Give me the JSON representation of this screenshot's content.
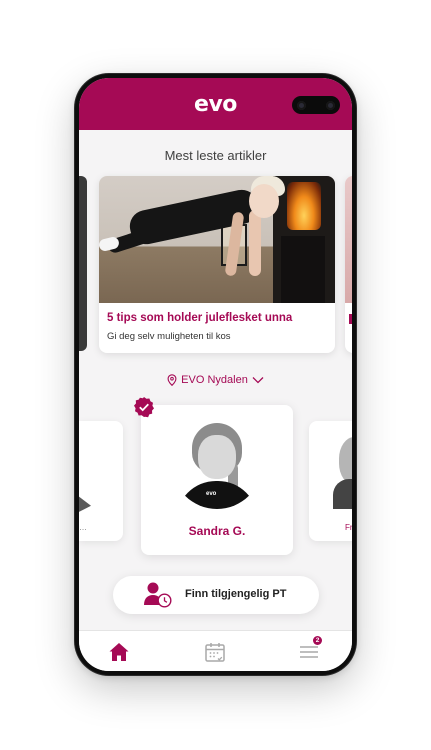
{
  "app": {
    "logo": "evo",
    "brand_color": "#a50a55"
  },
  "articles": {
    "section_title": "Mest leste artikler",
    "items": [
      {
        "title": "5 tips som holder juleflesket unna",
        "subtitle": "Gi deg selv muligheten til kos"
      }
    ]
  },
  "location": {
    "label": "EVO Nydalen",
    "icon": "location-pin-icon",
    "chevron": "chevron-down-icon"
  },
  "trainers": {
    "items": [
      {
        "name": "Sandra G.",
        "verified": true
      }
    ],
    "peek_left_text": "…",
    "peek_right_text": "Fr"
  },
  "find_pt": {
    "label": "Finn tilgjengelig PT",
    "icon": "trainer-clock-icon"
  },
  "bottom_nav": {
    "items": [
      {
        "icon": "home-icon",
        "active": true
      },
      {
        "icon": "calendar-icon",
        "active": false
      },
      {
        "icon": "menu-icon",
        "active": false,
        "badge": "2"
      }
    ]
  }
}
